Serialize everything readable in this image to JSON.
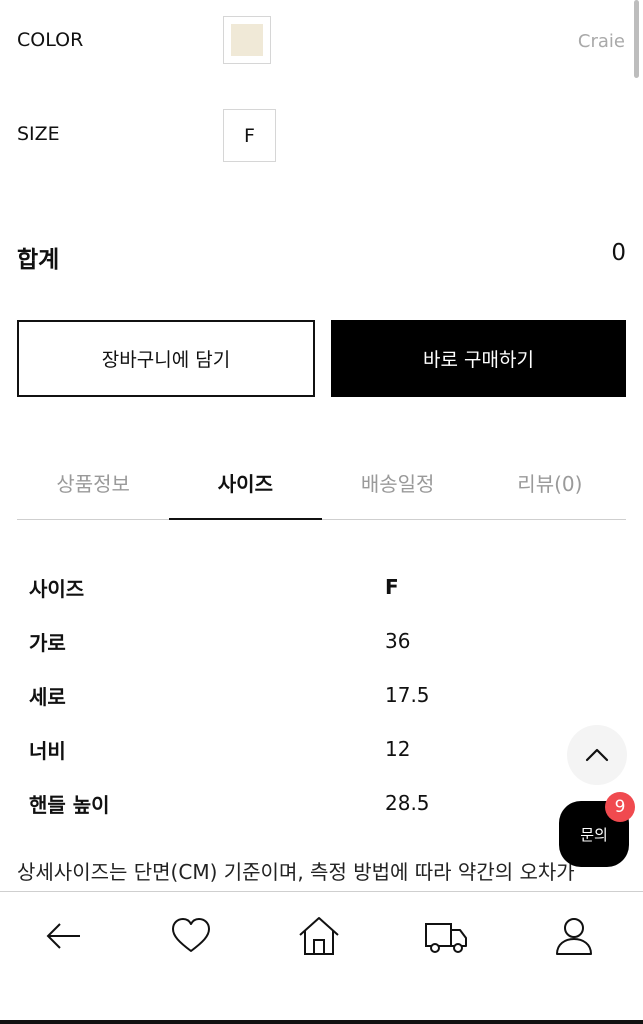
{
  "options": {
    "color_label": "COLOR",
    "color_value": "Craie",
    "color_swatch": "#f0e9d7",
    "size_label": "SIZE",
    "size_value": "F"
  },
  "total": {
    "label": "합계",
    "value": "0"
  },
  "actions": {
    "cart": "장바구니에 담기",
    "buy": "바로 구매하기"
  },
  "tabs": [
    {
      "label": "상품정보",
      "active": false
    },
    {
      "label": "사이즈",
      "active": true
    },
    {
      "label": "배송일정",
      "active": false
    },
    {
      "label": "리뷰(0)",
      "active": false
    }
  ],
  "size_table": {
    "rows": [
      {
        "key": "사이즈",
        "value": "F"
      },
      {
        "key": "가로",
        "value": "36"
      },
      {
        "key": "세로",
        "value": "17.5"
      },
      {
        "key": "너비",
        "value": "12"
      },
      {
        "key": "핸들 높이",
        "value": "28.5"
      }
    ]
  },
  "note": "상세사이즈는 단면(CM) 기준이며, 측정 방법에 따라 약간의 오차가",
  "floating": {
    "inquiry_label": "문의",
    "badge_count": "9"
  },
  "nav": {
    "icons": [
      "back-arrow-icon",
      "heart-icon",
      "home-icon",
      "truck-icon",
      "user-icon"
    ]
  }
}
